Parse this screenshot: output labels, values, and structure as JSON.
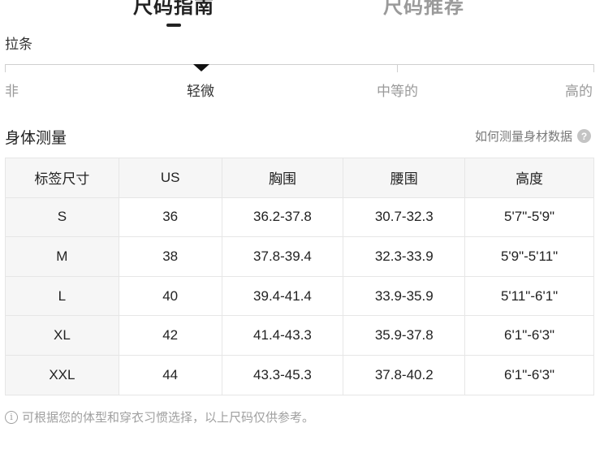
{
  "tabs": {
    "active_label": "尺码指南",
    "inactive_label": "尺码推荐"
  },
  "stretch": {
    "label": "拉条",
    "levels": [
      "非",
      "轻微",
      "中等的",
      "高的"
    ],
    "selected_index": 1
  },
  "body_measurement": {
    "title": "身体测量",
    "how_to_measure_link": "如何测量身材数据",
    "help_icon": "question-icon"
  },
  "table": {
    "headers": [
      "标签尺寸",
      "US",
      "胸围",
      "腰围",
      "高度"
    ],
    "rows": [
      [
        "S",
        "36",
        "36.2-37.8",
        "30.7-32.3",
        "5'7\"-5'9\""
      ],
      [
        "M",
        "38",
        "37.8-39.4",
        "32.3-33.9",
        "5'9\"-5'11\""
      ],
      [
        "L",
        "40",
        "39.4-41.4",
        "33.9-35.9",
        "5'11\"-6'1\""
      ],
      [
        "XL",
        "42",
        "41.4-43.3",
        "35.9-37.8",
        "6'1\"-6'3\""
      ],
      [
        "XXL",
        "44",
        "43.3-45.3",
        "37.8-40.2",
        "6'1\"-6'3\""
      ]
    ]
  },
  "footnote": {
    "icon": "info-icon",
    "text": "可根据您的体型和穿衣习惯选择，以上尺码仅供参考。"
  },
  "colors": {
    "text_primary": "#222222",
    "text_muted": "#9a9a9a",
    "header_bg": "#f6f6f6",
    "border": "#e6e6e6"
  }
}
